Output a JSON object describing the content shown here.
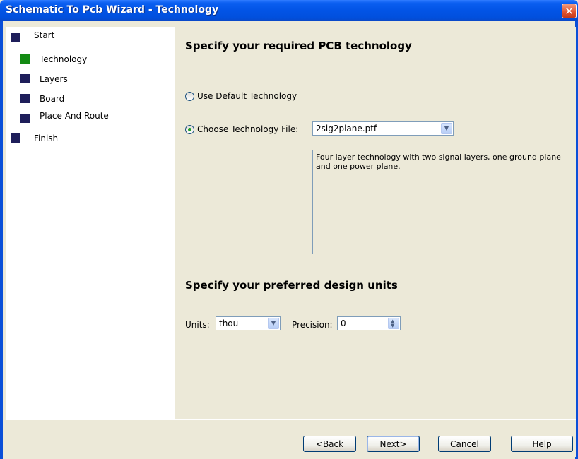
{
  "window": {
    "title": "Schematic To Pcb Wizard - Technology",
    "close_glyph": "✕"
  },
  "sidebar": {
    "steps": [
      {
        "label": "Start",
        "active": false
      },
      {
        "label": "Technology",
        "active": true
      },
      {
        "label": "Layers",
        "active": false
      },
      {
        "label": "Board",
        "active": false
      },
      {
        "label": "Place And Route",
        "active": false
      },
      {
        "label": "Finish",
        "active": false
      }
    ]
  },
  "technology": {
    "heading": "Specify your required PCB technology",
    "option_default": "Use Default Technology",
    "option_file": "Choose Technology File:",
    "selected_option": "file",
    "file_value": "2sig2plane.ptf",
    "description": "Four layer technology with two signal layers, one ground plane and one power plane."
  },
  "units": {
    "heading": "Specify your preferred design units",
    "units_label": "Units:",
    "units_value": "thou",
    "precision_label": "Precision:",
    "precision_value": "0"
  },
  "buttons": {
    "back_prefix": "< ",
    "back_label": "Back",
    "next_label": "Next",
    "next_suffix": " >",
    "cancel_label": "Cancel",
    "help_label": "Help"
  },
  "colors": {
    "titlebar": "#0254e6",
    "active_step": "#138a13",
    "step_square": "#1e1e5a",
    "radio_check": "#21a121"
  }
}
